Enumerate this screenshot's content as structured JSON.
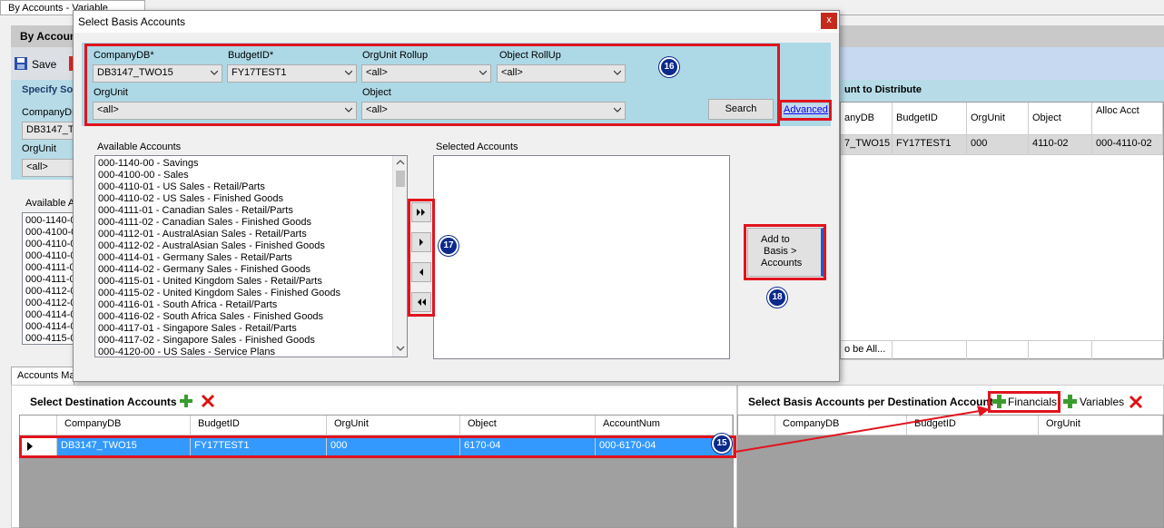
{
  "background": {
    "tab_title": "By Accounts - Variable",
    "panel_title": "By Accoun",
    "save_label": "Save",
    "specify_label": "Specify So",
    "companydb_label": "CompanyDB",
    "companydb_value": "DB3147_TW",
    "orgunit_label": "OrgUnit",
    "orgunit_value": "<all>",
    "available_label": "Available A",
    "available_items": [
      "000-1140-0",
      "000-4100-0",
      "000-4110-0",
      "000-4110-0",
      "000-4111-0",
      "000-4111-0",
      "000-4112-0",
      "000-4112-0",
      "000-4114-0",
      "000-4114-0",
      "000-4115-0"
    ],
    "tab_accounts": "Accounts Ma",
    "right_header": "unt to Distribute",
    "right_grid": {
      "headers": [
        "anyDB",
        "BudgetID",
        "OrgUnit",
        "Object",
        "Alloc Acct"
      ],
      "row": [
        "7_TWO15",
        "FY17TEST1",
        "000",
        "4110-02",
        "000-4110-02"
      ]
    },
    "right_footer": "o be All..."
  },
  "dialog": {
    "title": "Select Basis Accounts",
    "close_label": "x",
    "filters": {
      "companydb_label": "CompanyDB*",
      "companydb_value": "DB3147_TWO15",
      "budgetid_label": "BudgetID*",
      "budgetid_value": "FY17TEST1",
      "orgunit_rollup_label": "OrgUnit Rollup",
      "orgunit_rollup_value": "<all>",
      "object_rollup_label": "Object RollUp",
      "object_rollup_value": "<all>",
      "orgunit_label": "OrgUnit",
      "orgunit_value": "<all>",
      "object_label": "Object",
      "object_value": "<all>",
      "search_label": "Search",
      "advanced_label": "Advanced"
    },
    "available_label": "Available Accounts",
    "available_items": [
      "000-1140-00 - Savings",
      "000-4100-00 - Sales",
      "000-4110-01 - US Sales - Retail/Parts",
      "000-4110-02 - US Sales - Finished Goods",
      "000-4111-01 - Canadian Sales - Retail/Parts",
      "000-4111-02 - Canadian Sales - Finished Goods",
      "000-4112-01 - AustralAsian Sales - Retail/Parts",
      "000-4112-02 - AustralAsian Sales - Finished Goods",
      "000-4114-01 - Germany Sales - Retail/Parts",
      "000-4114-02 - Germany Sales - Finished Goods",
      "000-4115-01 - United Kingdom Sales - Retail/Parts",
      "000-4115-02 - United Kingdom Sales - Finished Goods",
      "000-4116-01 - South Africa - Retail/Parts",
      "000-4116-02 - South Africa Sales - Finished Goods",
      "000-4117-01 - Singapore Sales - Retail/Parts",
      "000-4117-02 - Singapore Sales - Finished Goods",
      "000-4120-00 - US Sales - Service Plans"
    ],
    "selected_label": "Selected Accounts",
    "add_button_lines": [
      "Add to",
      "Basis  >",
      "Accounts"
    ]
  },
  "badges": {
    "b15": "15",
    "b16": "16",
    "b17": "17",
    "b18": "18"
  },
  "destination": {
    "title": "Select Destination Accounts",
    "headers": [
      "CompanyDB",
      "BudgetID",
      "OrgUnit",
      "Object",
      "AccountNum"
    ],
    "row": [
      "DB3147_TWO15",
      "FY17TEST1",
      "000",
      "6170-04",
      "000-6170-04"
    ]
  },
  "basis_per_dest": {
    "title": "Select Basis Accounts per Destination Account",
    "financials_label": "Financials",
    "variables_label": "Variables",
    "headers": [
      "CompanyDB",
      "BudgetID",
      "OrgUnit"
    ]
  },
  "colors": {
    "highlight_red": "#e0141e",
    "badge_blue": "#0b2a8c",
    "selection_blue": "#3399ff",
    "filter_bg": "#add8e6"
  }
}
